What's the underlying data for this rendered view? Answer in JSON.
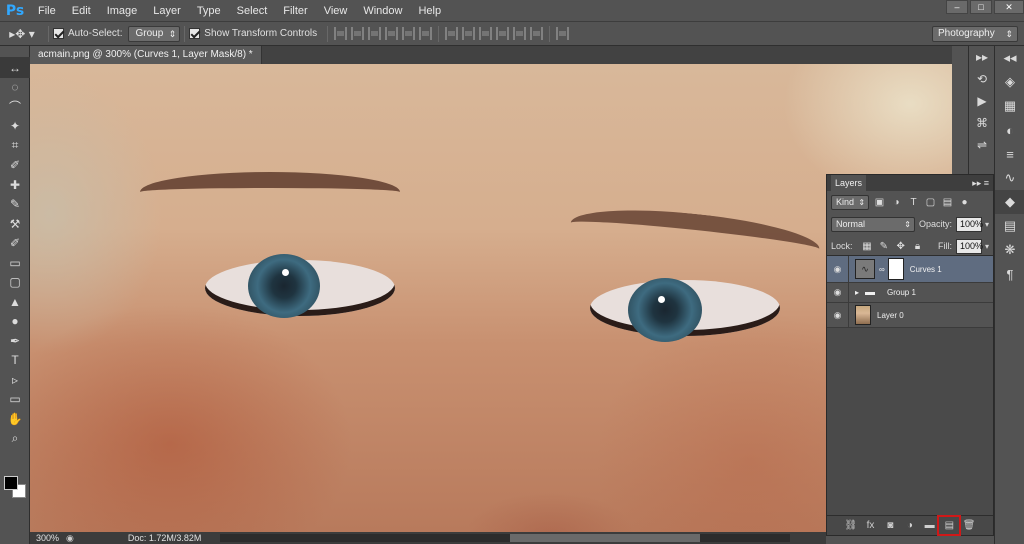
{
  "app": {
    "logo": "Ps",
    "menu": [
      "File",
      "Edit",
      "Image",
      "Layer",
      "Type",
      "Select",
      "Filter",
      "View",
      "Window",
      "Help"
    ],
    "window_controls": [
      "–",
      "□",
      "✕"
    ]
  },
  "options_bar": {
    "tool_icon": "move-tool-icon",
    "auto_select_label": "Auto-Select:",
    "auto_select_checked": true,
    "auto_select_target": "Group",
    "show_transform_label": "Show Transform Controls",
    "show_transform_checked": true,
    "workspace": "Photography"
  },
  "document": {
    "tab_title": "acmain.png @ 300% (Curves 1, Layer Mask/8) *"
  },
  "tools": [
    "↔",
    "◌",
    "⌒",
    "✦",
    "⌗",
    "✐",
    "✚",
    "✎",
    "⚒",
    "✐",
    "▭",
    "▢",
    "▲",
    "●",
    "✒",
    "T",
    "▹",
    "▭",
    "✋",
    "⌕"
  ],
  "status": {
    "zoom": "300%",
    "doc_size": "Doc: 1.72M/3.82M",
    "arrow": "▶"
  },
  "layers_panel": {
    "title": "Layers",
    "filter_kind": "Kind",
    "blend_mode": "Normal",
    "opacity_label": "Opacity:",
    "opacity_value": "100%",
    "lock_label": "Lock:",
    "fill_label": "Fill:",
    "fill_value": "100%",
    "layers": [
      {
        "name": "Curves 1",
        "type": "adjustment",
        "selected": true
      },
      {
        "name": "Group 1",
        "type": "group",
        "selected": false
      },
      {
        "name": "Layer 0",
        "type": "image",
        "selected": false
      }
    ],
    "footer_icons": [
      "link-icon",
      "fx-icon",
      "mask-icon",
      "adjustment-icon",
      "folder-icon",
      "new-layer-icon",
      "trash-icon"
    ],
    "highlight_color": "#d01818"
  }
}
